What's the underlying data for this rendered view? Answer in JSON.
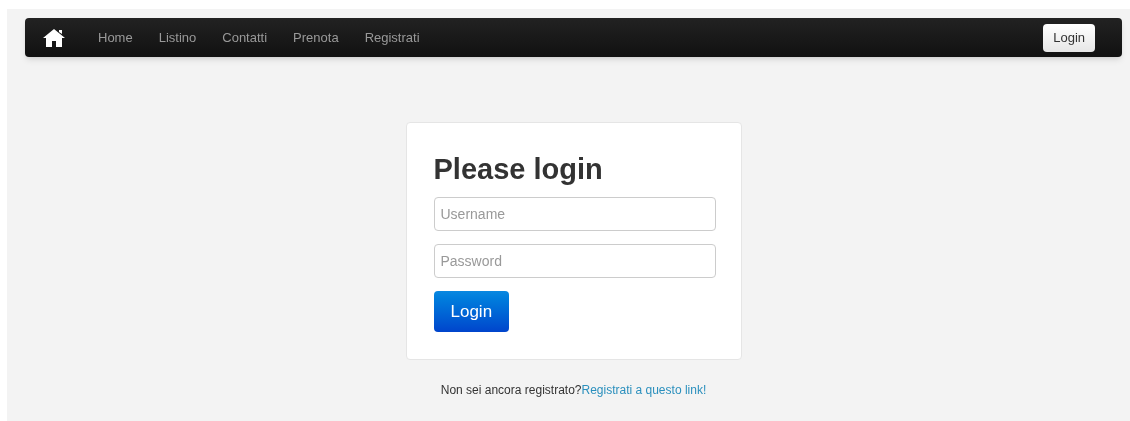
{
  "navbar": {
    "items": [
      {
        "label": "Home"
      },
      {
        "label": "Listino"
      },
      {
        "label": "Contatti"
      },
      {
        "label": "Prenota"
      },
      {
        "label": "Registrati"
      }
    ],
    "login_button": "Login"
  },
  "login_form": {
    "title": "Please login",
    "fields": [
      {
        "placeholder": "Username"
      },
      {
        "placeholder": "Password"
      }
    ],
    "submit": "Login"
  },
  "footer": {
    "text": "Non sei ancora registrato?",
    "link": "Registrati a questo link!"
  }
}
